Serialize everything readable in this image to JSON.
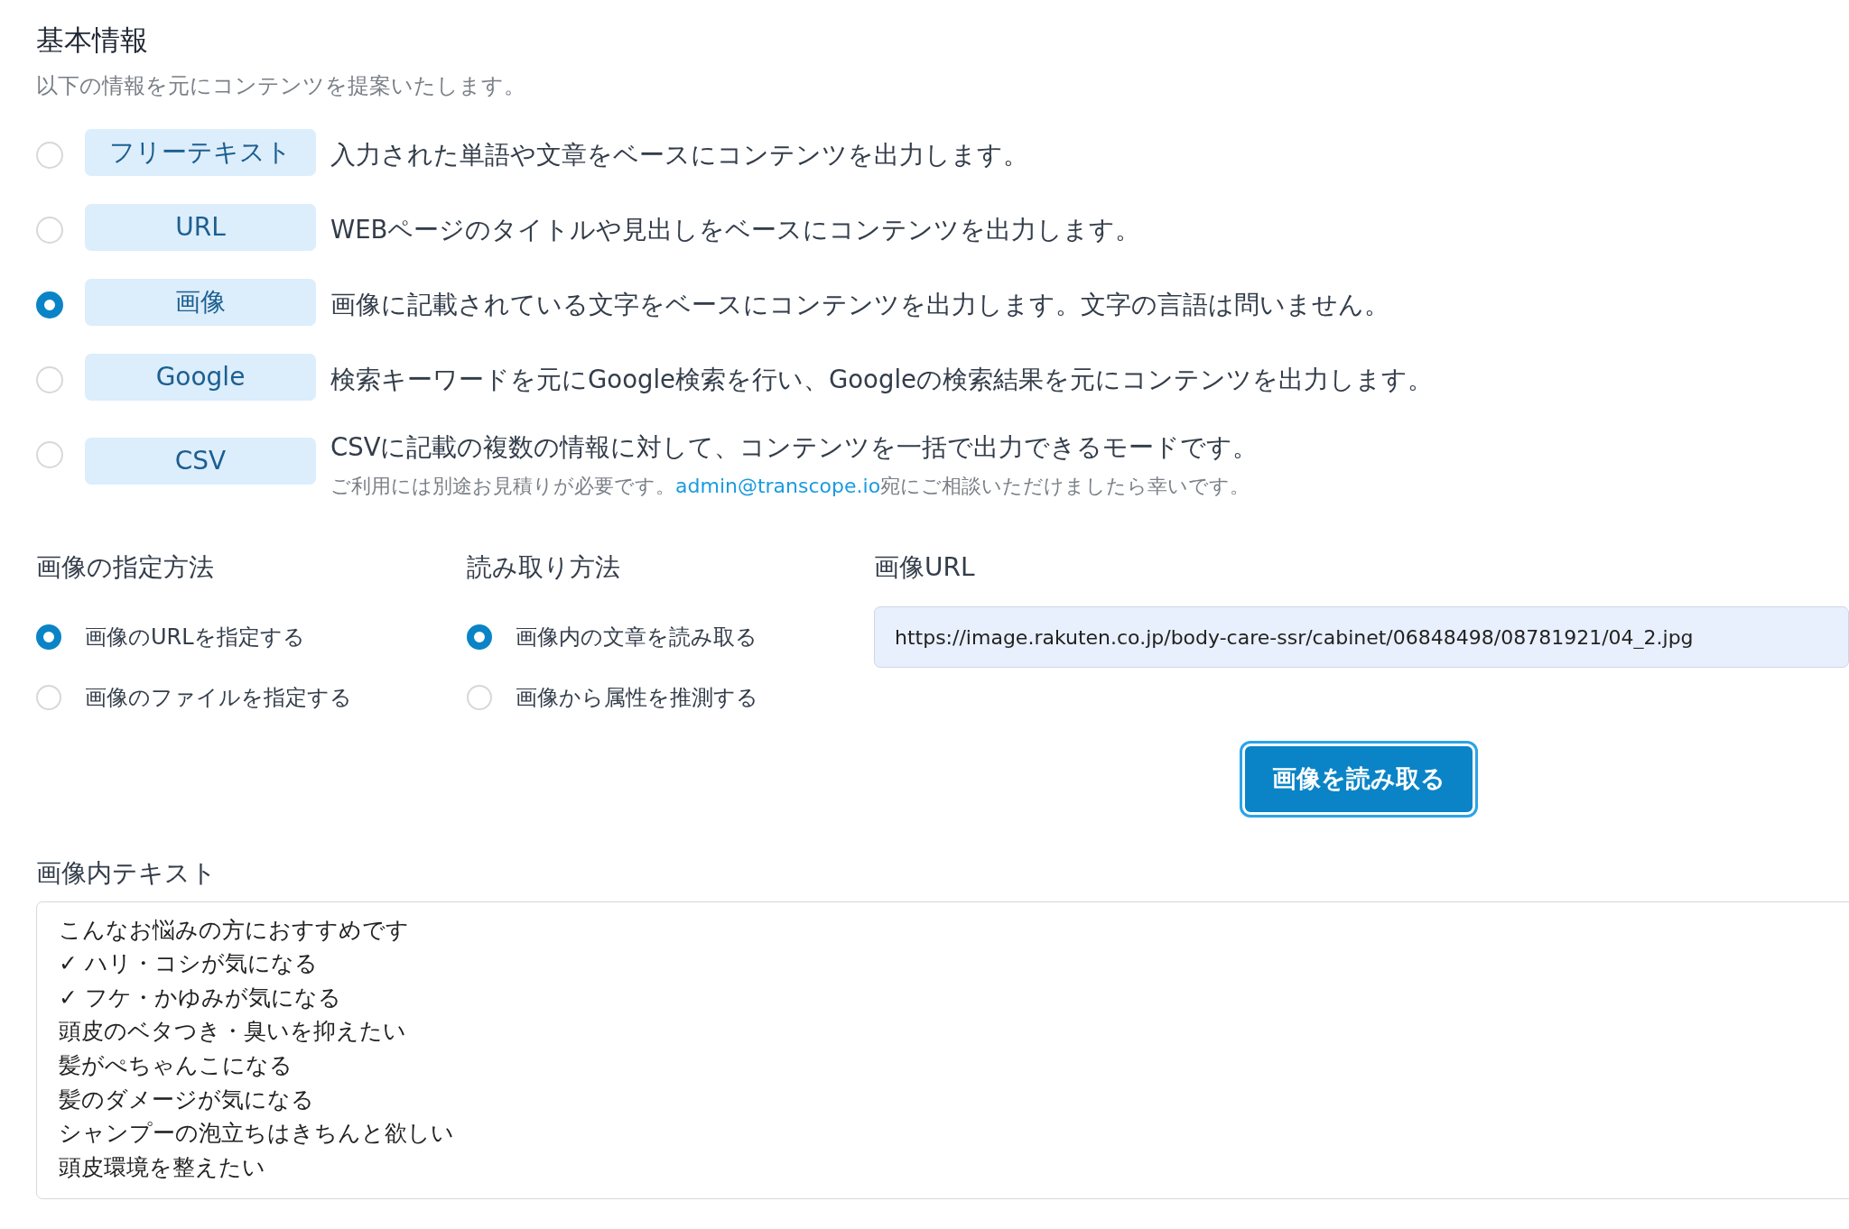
{
  "section": {
    "title": "基本情報",
    "subtitle": "以下の情報を元にコンテンツを提案いたします。"
  },
  "modes": [
    {
      "label": "フリーテキスト",
      "description": "入力された単語や文章をベースにコンテンツを出力します。",
      "selected": false
    },
    {
      "label": "URL",
      "description": "WEBページのタイトルや見出しをベースにコンテンツを出力します。",
      "selected": false
    },
    {
      "label": "画像",
      "description": "画像に記載されている文字をベースにコンテンツを出力します。文字の言語は問いません。",
      "selected": true
    },
    {
      "label": "Google",
      "description": "検索キーワードを元にGoogle検索を行い、Googleの検索結果を元にコンテンツを出力します。",
      "selected": false
    },
    {
      "label": "CSV",
      "description": "CSVに記載の複数の情報に対して、コンテンツを一括で出力できるモードです。",
      "selected": false,
      "note": {
        "before": "ご利用には別途お見積りが必要です。",
        "link": "admin@transcope.io",
        "after": "宛にご相談いただけましたら幸いです。"
      }
    }
  ],
  "image_source": {
    "label": "画像の指定方法",
    "options": [
      {
        "label": "画像のURLを指定する",
        "selected": true
      },
      {
        "label": "画像のファイルを指定する",
        "selected": false
      }
    ]
  },
  "read_method": {
    "label": "読み取り方法",
    "options": [
      {
        "label": "画像内の文章を読み取る",
        "selected": true
      },
      {
        "label": "画像から属性を推測する",
        "selected": false
      }
    ]
  },
  "image_url": {
    "label": "画像URL",
    "value": "https://image.rakuten.co.jp/body-care-ssr/cabinet/06848498/08781921/04_2.jpg"
  },
  "read_button": "画像を読み取る",
  "image_text": {
    "label": "画像内テキスト",
    "lines": [
      "こんなお悩みの方におすすめです",
      "✓ ハリ・コシが気になる",
      "✓ フケ・かゆみが気になる",
      "頭皮のベタつき・臭いを抑えたい",
      "髪がぺちゃんこになる",
      "髪のダメージが気になる",
      "シャンプーの泡立ちはきちんと欲しい",
      "頭皮環境を整えたい"
    ]
  }
}
